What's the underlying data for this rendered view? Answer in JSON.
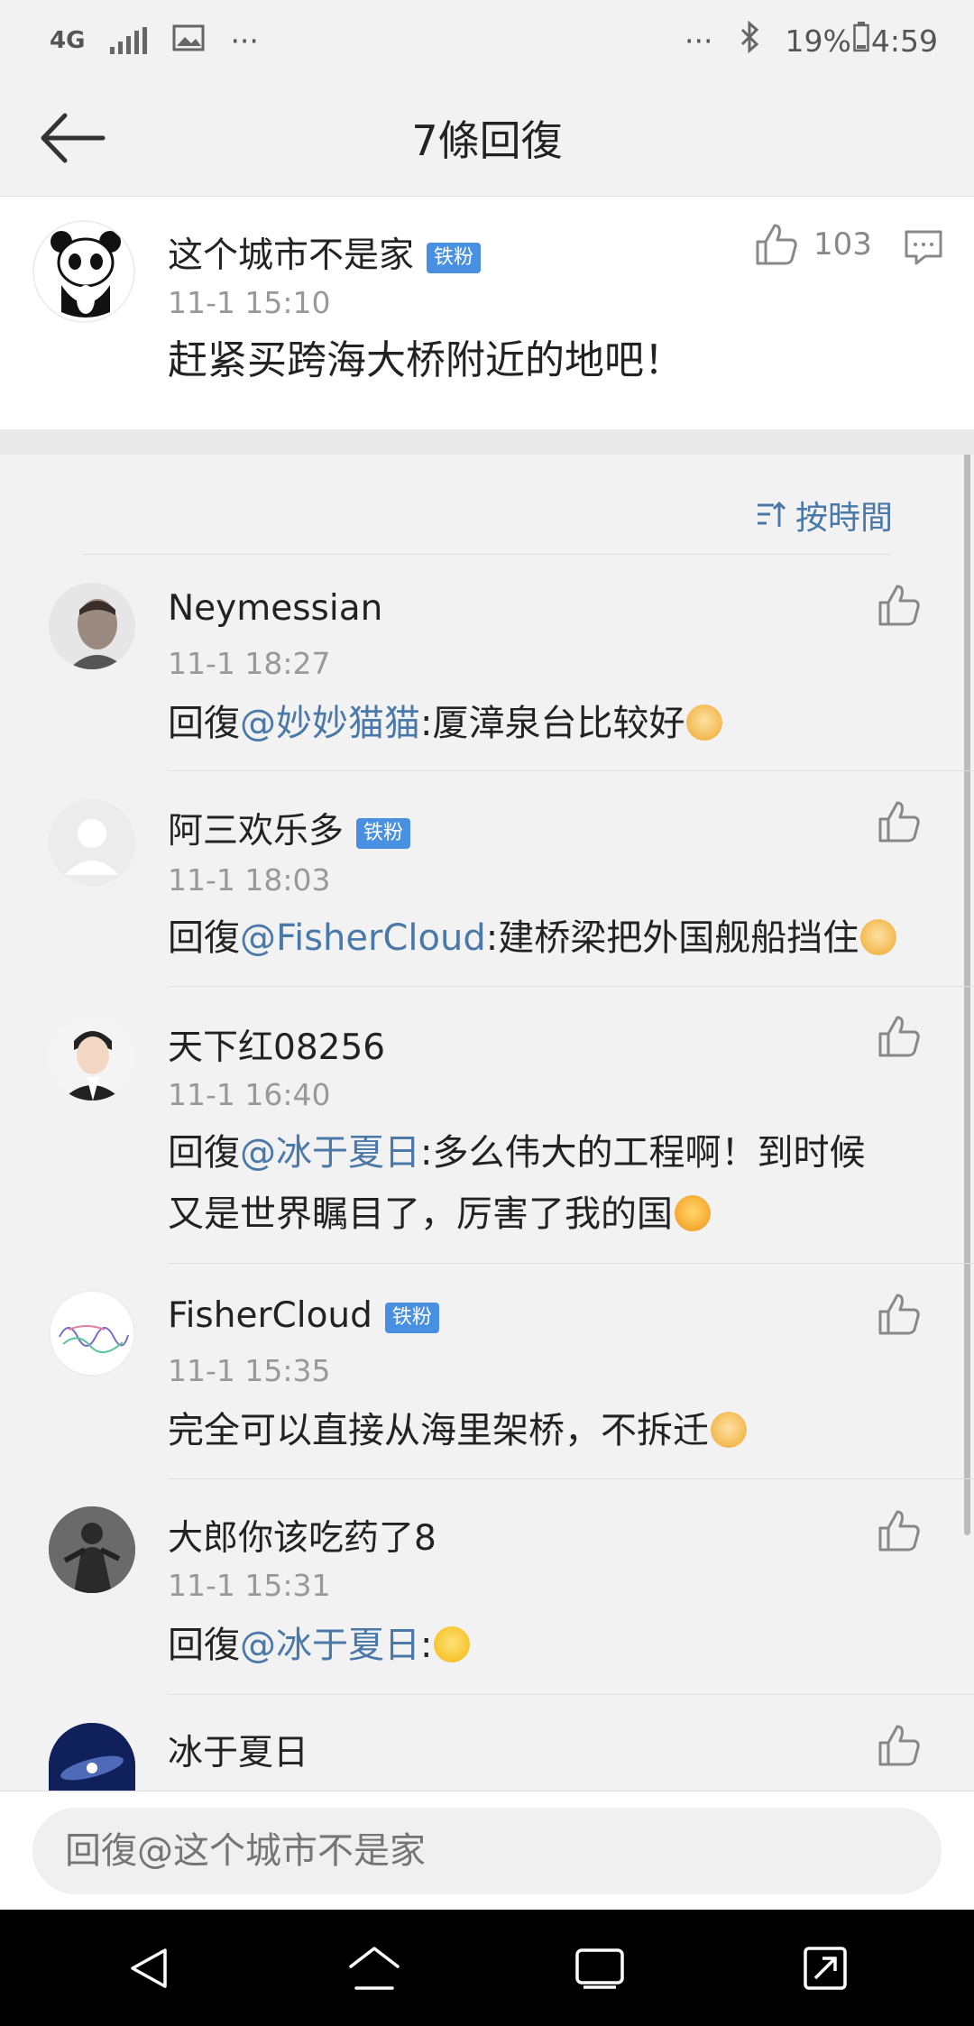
{
  "status_bar": {
    "network": "4G",
    "more_left": "···",
    "more_right": "···",
    "battery": "19%",
    "time": "4:59"
  },
  "nav": {
    "title": "7條回復"
  },
  "main_comment": {
    "user": "这个城市不是家",
    "badge": "铁粉",
    "time": "11-1 15:10",
    "text": "赶紧买跨海大桥附近的地吧！",
    "likes": "103"
  },
  "sort": {
    "label": "按時間"
  },
  "replies": [
    {
      "user": "Neymessian",
      "badge": "",
      "time": "11-1 18:27",
      "prefix": "回復",
      "mention": "@妙妙猫猫",
      "text": ":厦漳泉台比较好",
      "text2": ""
    },
    {
      "user": "阿三欢乐多",
      "badge": "铁粉",
      "time": "11-1 18:03",
      "prefix": "回復",
      "mention": "@FisherCloud",
      "text": ":建桥梁把外国舰船挡住",
      "text2": ""
    },
    {
      "user": "天下红08256",
      "badge": "",
      "time": "11-1 16:40",
      "prefix": "回復",
      "mention": "@冰于夏日",
      "text": ":多么伟大的工程啊！到时候",
      "text2": "又是世界瞩目了，厉害了我的国"
    },
    {
      "user": "FisherCloud",
      "badge": "铁粉",
      "time": "11-1 15:35",
      "prefix": "",
      "mention": "",
      "text": "完全可以直接从海里架桥，不拆迁",
      "text2": ""
    },
    {
      "user": "大郎你该吃药了8",
      "badge": "",
      "time": "11-1 15:31",
      "prefix": "回復",
      "mention": "@冰于夏日",
      "text": ":",
      "text2": ""
    },
    {
      "user": "冰于夏日",
      "badge": "",
      "time": "",
      "prefix": "",
      "mention": "",
      "text": "",
      "text2": ""
    }
  ],
  "reply_bar": {
    "placeholder": "回復@这个城市不是家"
  },
  "colors": {
    "accent": "#4a78a8",
    "badge": "#4a90e2",
    "background": "#f2f2f2"
  }
}
